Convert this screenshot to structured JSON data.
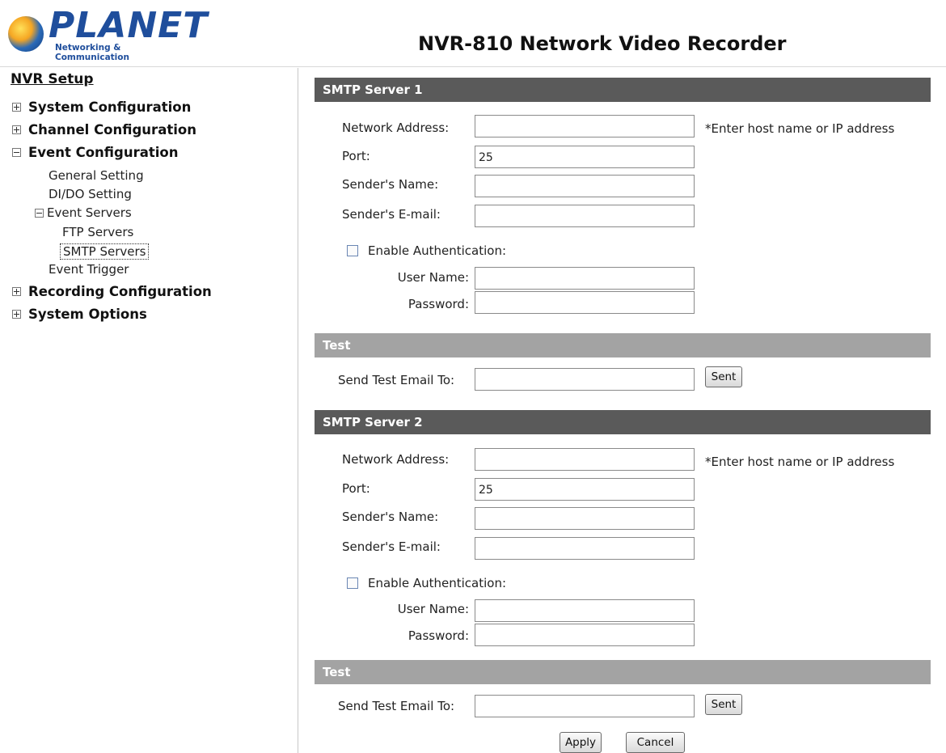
{
  "brand": {
    "name": "PLANET",
    "tagline": "Networking & Communication"
  },
  "header": {
    "title": "NVR-810 Network Video Recorder"
  },
  "sidebar": {
    "heading": "NVR Setup",
    "items": [
      {
        "label": "System Configuration",
        "state": "collapsed"
      },
      {
        "label": "Channel Configuration",
        "state": "collapsed"
      },
      {
        "label": "Event Configuration",
        "state": "expanded",
        "children": [
          {
            "label": "General Setting"
          },
          {
            "label": "DI/DO Setting"
          },
          {
            "label": "Event Servers",
            "state": "expanded",
            "children": [
              {
                "label": "FTP Servers"
              },
              {
                "label": "SMTP Servers",
                "selected": true
              }
            ]
          },
          {
            "label": "Event Trigger"
          }
        ]
      },
      {
        "label": "Recording Configuration",
        "state": "collapsed"
      },
      {
        "label": "System Options",
        "state": "collapsed"
      }
    ]
  },
  "server1": {
    "title": "SMTP Server 1",
    "network_address_label": "Network Address:",
    "network_address_value": "",
    "network_address_hint": "*Enter host name or IP address",
    "port_label": "Port:",
    "port_value": "25",
    "sender_name_label": "Sender's Name:",
    "sender_name_value": "",
    "sender_email_label": "Sender's E-mail:",
    "sender_email_value": "",
    "auth_label": "Enable Authentication:",
    "auth_checked": false,
    "username_label": "User Name:",
    "password_label": "Password:",
    "test_title": "Test",
    "test_label": "Send Test Email To:",
    "test_button": "Sent"
  },
  "server2": {
    "title": "SMTP Server 2",
    "network_address_label": "Network Address:",
    "network_address_value": "",
    "network_address_hint": "*Enter host name or IP address",
    "port_label": "Port:",
    "port_value": "25",
    "sender_name_label": "Sender's Name:",
    "sender_name_value": "",
    "sender_email_label": "Sender's E-mail:",
    "sender_email_value": "",
    "auth_label": "Enable Authentication:",
    "auth_checked": false,
    "username_label": "User Name:",
    "password_label": "Password:",
    "test_title": "Test",
    "test_label": "Send Test Email To:",
    "test_button": "Sent"
  },
  "actions": {
    "apply": "Apply",
    "cancel": "Cancel"
  },
  "colors": {
    "section_bar_dark": "#5a5a5a",
    "section_bar_light": "#a3a3a3",
    "brand_blue": "#1f4e9c"
  }
}
